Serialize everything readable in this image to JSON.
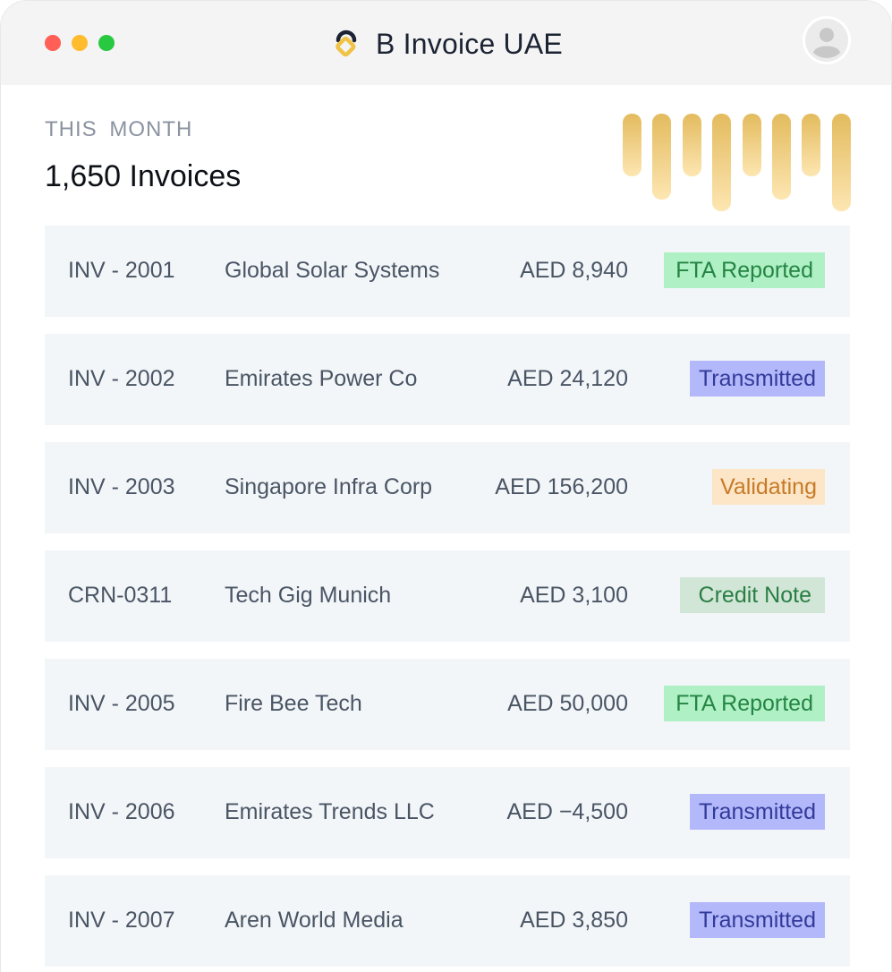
{
  "app": {
    "title": "B Invoice UAE",
    "logo_icon": "brand-logo-icon",
    "avatar_icon": "user-avatar-icon",
    "accent_color": "#e3bb5e"
  },
  "summary": {
    "period_label": "THIS MONTH",
    "count_label": "1,650 Invoices"
  },
  "invoices": [
    {
      "id": "INV - 2001",
      "client": "Global Solar Systems",
      "amount": "AED 8,940",
      "status": "FTA Reported"
    },
    {
      "id": "INV - 2002",
      "client": "Emirates Power Co",
      "amount": "AED 24,120",
      "status": "Transmitted"
    },
    {
      "id": "INV - 2003",
      "client": "Singapore Infra Corp",
      "amount": "AED 156,200",
      "status": "Validating"
    },
    {
      "id": "CRN-0311",
      "client": "Tech Gig Munich",
      "amount": "AED 3,100",
      "status": "Credit Note"
    },
    {
      "id": "INV - 2005",
      "client": "Fire Bee Tech",
      "amount": "AED 50,000",
      "status": "FTA Reported"
    },
    {
      "id": "INV - 2006",
      "client": "Emirates Trends LLC",
      "amount": "AED −4,500",
      "status": "Transmitted"
    },
    {
      "id": "INV - 2007",
      "client": "Aren World Media",
      "amount": "AED 3,850",
      "status": "Transmitted"
    }
  ],
  "status_colors": {
    "FTA Reported": {
      "bg": "#aff0c4",
      "fg": "#248544"
    },
    "Transmitted": {
      "bg": "#b3b8fa",
      "fg": "#323b9a"
    },
    "Validating": {
      "bg": "#fde5c7",
      "fg": "#c77a26"
    },
    "Credit Note": {
      "bg": "#d1e6d6",
      "fg": "#2a7e45"
    }
  },
  "sparkline": {
    "levels": [
      0.64,
      0.88,
      0.64,
      1.0,
      0.64,
      0.88,
      0.64,
      1.0
    ]
  }
}
